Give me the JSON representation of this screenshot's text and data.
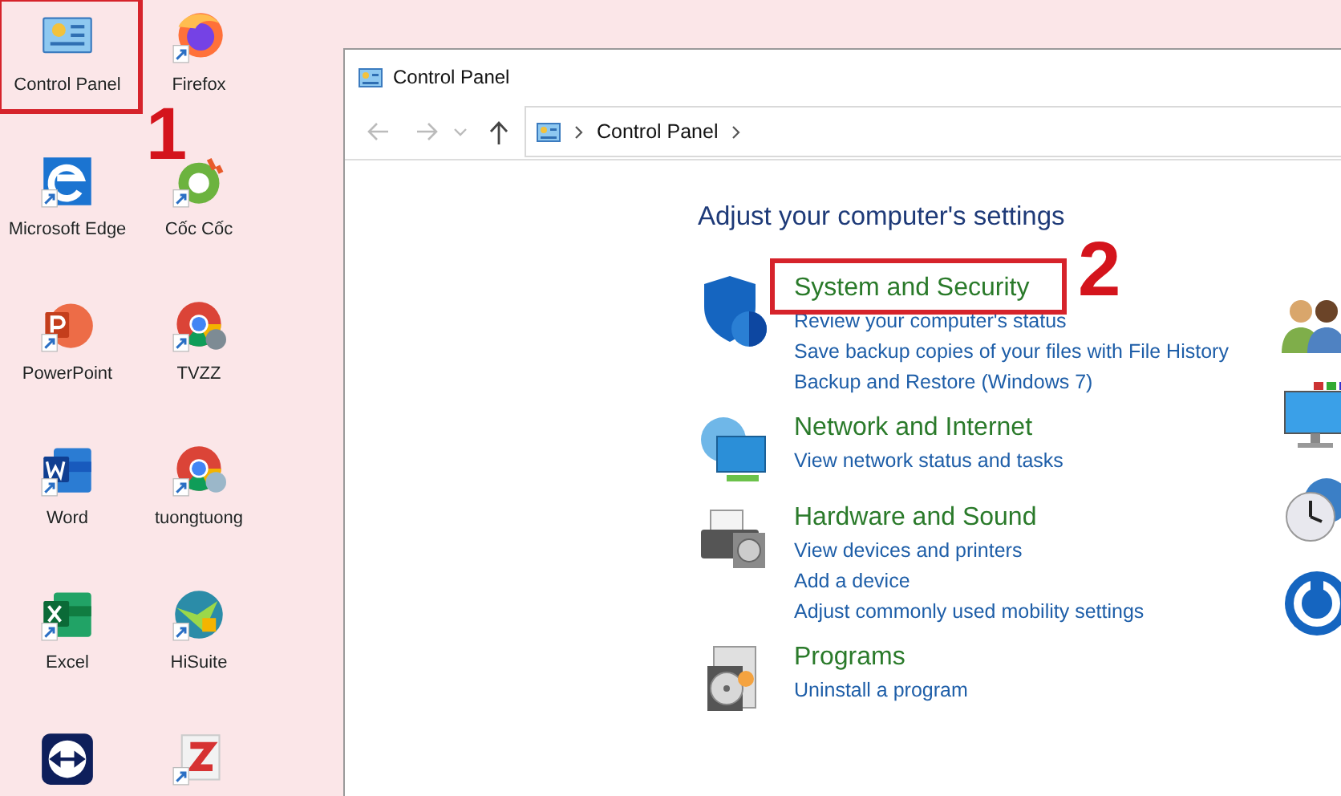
{
  "desktop": {
    "icons": [
      {
        "kind": "app",
        "label": "Control Panel",
        "highlighted": true,
        "annotation": "1"
      },
      {
        "kind": "shortcut",
        "label": "Firefox"
      },
      {
        "kind": "shortcut",
        "label": "Microsoft Edge"
      },
      {
        "kind": "shortcut",
        "label": "Cốc Cốc"
      },
      {
        "kind": "shortcut",
        "label": "PowerPoint"
      },
      {
        "kind": "shortcut",
        "label": "TVZZ"
      },
      {
        "kind": "shortcut",
        "label": "Word"
      },
      {
        "kind": "shortcut",
        "label": "tuongtuong"
      },
      {
        "kind": "shortcut",
        "label": "Excel"
      },
      {
        "kind": "shortcut",
        "label": "HiSuite"
      },
      {
        "kind": "app"
      },
      {
        "kind": "shortcut"
      }
    ]
  },
  "window": {
    "title": "Control Panel",
    "address": {
      "path": [
        "Control Panel"
      ]
    },
    "heading": "Adjust your computer's settings",
    "categories": [
      {
        "title": "System and Security",
        "highlighted": true,
        "annotation": "2",
        "links": [
          "Review your computer's status",
          "Save backup copies of your files with File History",
          "Backup and Restore (Windows 7)"
        ]
      },
      {
        "title": "Network and Internet",
        "links": [
          "View network status and tasks"
        ]
      },
      {
        "title": "Hardware and Sound",
        "links": [
          "View devices and printers",
          "Add a device",
          "Adjust commonly used mobility settings"
        ]
      },
      {
        "title": "Programs",
        "links": [
          "Uninstall a program"
        ]
      }
    ]
  }
}
